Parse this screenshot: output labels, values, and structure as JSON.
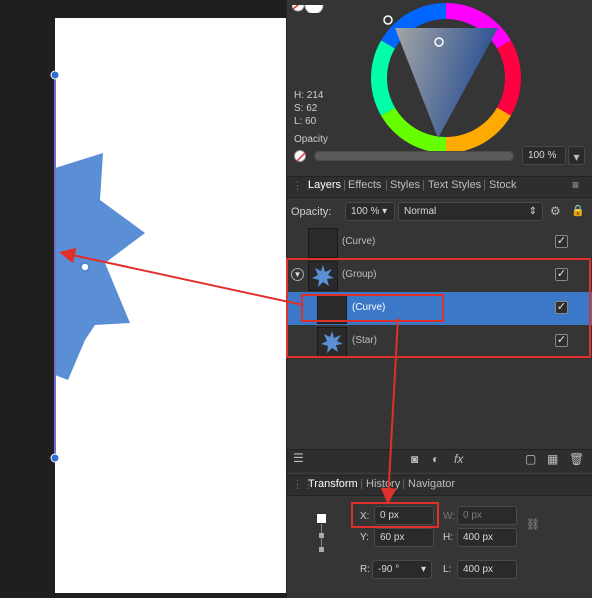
{
  "color": {
    "h_label": "H: 214",
    "s_label": "S: 62",
    "l_label": "L: 60",
    "opacity_label": "Opacity",
    "opacity_value": "100 %",
    "opacity_fraction": 1.0
  },
  "layers_panel": {
    "tabs": [
      "Layers",
      "Effects",
      "Styles",
      "Text Styles",
      "Stock"
    ],
    "opacity_label": "Opacity:",
    "opacity_value": "100 %",
    "blend_mode": "Normal",
    "rows": [
      {
        "name": "(Curve)",
        "checked": "✓"
      },
      {
        "name": "(Group)",
        "checked": "✓"
      },
      {
        "name": "(Curve)",
        "checked": "✓"
      },
      {
        "name": "(Star)",
        "checked": "✓"
      }
    ]
  },
  "transform_panel": {
    "tabs": [
      "Transform",
      "History",
      "Navigator"
    ],
    "x_label": "X:",
    "x_value": "0 px",
    "y_label": "Y:",
    "y_value": "60 px",
    "w_label": "W:",
    "w_value": "0 px",
    "h_label": "H:",
    "h_value": "400 px",
    "r_label": "R:",
    "r_value": "-90 °",
    "l_label": "L:",
    "l_value": "400 px"
  },
  "colors": {
    "accent": "#4a80c8",
    "highlight_red": "#e0302a",
    "star_fill": "#5a8fd6"
  }
}
